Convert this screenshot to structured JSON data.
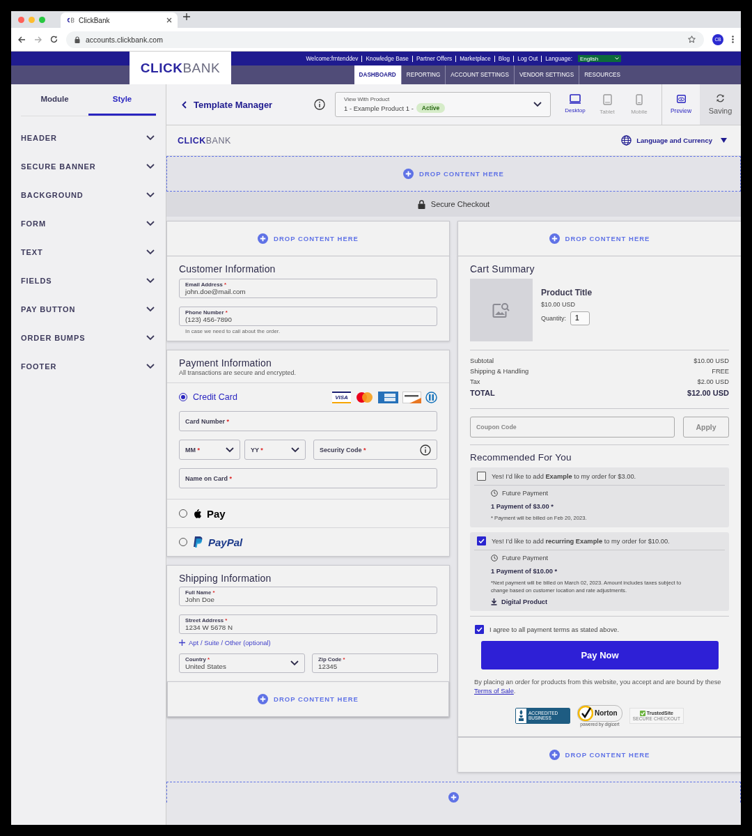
{
  "browser": {
    "tab_title": "ClickBank",
    "url": "accounts.clickbank.com",
    "avatar": "CB"
  },
  "site_header": {
    "logo_primary": "CLICK",
    "logo_secondary": "BANK",
    "links": [
      "Welcome:frntenddev",
      "Knowledge Base",
      "Partner Offers",
      "Marketplace",
      "Blog",
      "Log Out"
    ],
    "language_label": "Language:",
    "language_value": "English",
    "nav": [
      {
        "label": "DASHBOARD",
        "selected": true
      },
      {
        "label": "REPORTING",
        "selected": false
      },
      {
        "label": "ACCOUNT SETTINGS",
        "selected": false
      },
      {
        "label": "VENDOR SETTINGS",
        "selected": false
      },
      {
        "label": "RESOURCES",
        "selected": false
      }
    ]
  },
  "sidebar": {
    "tabs": [
      {
        "label": "Module",
        "selected": false
      },
      {
        "label": "Style",
        "selected": true
      }
    ],
    "sections": [
      "HEADER",
      "SECURE BANNER",
      "BACKGROUND",
      "FORM",
      "TEXT",
      "FIELDS",
      "PAY BUTTON",
      "ORDER BUMPS",
      "FOOTER"
    ]
  },
  "toolbar": {
    "title": "Template Manager",
    "product_select": {
      "label": "View With Product",
      "value": "1 - Example Product 1 -",
      "badge": "Active"
    },
    "devices": [
      {
        "kind": "desktop",
        "label": "Desktop",
        "selected": true
      },
      {
        "kind": "tablet",
        "label": "Tablet",
        "selected": false
      },
      {
        "kind": "mobile",
        "label": "Mobile",
        "selected": false
      }
    ],
    "preview": "Preview",
    "saving": "Saving"
  },
  "checkout": {
    "logo_primary": "CLICK",
    "logo_secondary": "BANK",
    "language": "Language and Currency",
    "header_drop": "DROP CONTENT HERE",
    "secure_banner": "Secure Checkout"
  },
  "left_column": {
    "drop_top": "DROP CONTENT HERE",
    "customer": {
      "title": "Customer Information",
      "fields": [
        {
          "label": "Email Address",
          "mark": "*",
          "value": "john.doe@mail.com"
        },
        {
          "label": "Phone Number",
          "mark": "*",
          "value": "(123) 456-7890"
        }
      ],
      "hint": "In case we need to call about the order."
    },
    "payment": {
      "title": "Payment Information",
      "subtitle": "All transactions are secure and encrypted.",
      "methods": [
        {
          "kind": "card",
          "label": "Credit Card",
          "selected": true
        },
        {
          "kind": "apple_pay",
          "label": "Pay",
          "selected": false
        },
        {
          "kind": "paypal",
          "label": "PayPal",
          "selected": false
        }
      ],
      "card_logos": [
        {
          "kind": "visa",
          "text": "VISA"
        },
        {
          "kind": "mastercard"
        },
        {
          "kind": "amex"
        },
        {
          "kind": "discover"
        },
        {
          "kind": "diners"
        }
      ],
      "card_fields": [
        {
          "label": "Card Number",
          "mark": "*"
        },
        {
          "kind": "select",
          "label": "MM",
          "mark": "*"
        },
        {
          "kind": "select",
          "label": "YY",
          "mark": "*"
        },
        {
          "kind": "info",
          "label": "Security Code",
          "mark": "*"
        },
        {
          "label": "Name on Card",
          "mark": "*"
        }
      ]
    },
    "shipping": {
      "title": "Shipping Information",
      "fields": [
        {
          "label": "Full Name",
          "mark": "*",
          "value": "John Doe"
        },
        {
          "label": "Street Address",
          "mark": "*",
          "value": "1234 W 5678 N"
        }
      ],
      "add_link": "Apt / Suite / Other (optional)",
      "row_fields": [
        {
          "kind": "select",
          "label": "Country",
          "mark": "*",
          "value": "United States"
        },
        {
          "label": "Zip Code",
          "mark": "*",
          "value": "12345"
        }
      ],
      "drop_bottom": "DROP CONTENT HERE"
    }
  },
  "cart": {
    "drop_top": "DROP CONTENT HERE",
    "title": "Cart Summary",
    "product": {
      "title": "Product Title",
      "price": "$10.00 USD",
      "quantity_label": "Quantity:",
      "quantity": "1"
    },
    "totals": [
      {
        "kind": "line",
        "label": "Subtotal",
        "value": "$10.00 USD"
      },
      {
        "kind": "line",
        "label": "Shipping & Handling",
        "value": "FREE"
      },
      {
        "kind": "line",
        "label": "Tax",
        "value": "$2.00 USD"
      },
      {
        "kind": "total",
        "label": "TOTAL",
        "value": "$12.00 USD"
      }
    ],
    "coupon_placeholder": "Coupon Code",
    "apply": "Apply",
    "recommended_title": "Recommended For You",
    "bumps": [
      {
        "checked": false,
        "text": "Yes! I'd like to add **Example** to my order for $3.00.",
        "schedule": "Future Payment",
        "payment": "1 Payment of $3.00 *",
        "note": "* Payment will be billed on Feb 20, 2023."
      },
      {
        "checked": true,
        "text": "Yes! I'd like to add **recurring Example** to my order for $10.00.",
        "schedule": "Future Payment",
        "payment": "1 Payment of $10.00 *",
        "note": "*Next payment will be billed on March 02, 2023. Amount includes taxes subject to change based on customer location and rate adjustments.",
        "digital": "Digital Product"
      }
    ],
    "agree": {
      "checked": true,
      "text": "I agree to all payment terms as stated above."
    },
    "pay_button": "Pay Now",
    "legal": {
      "text": "By placing an order for products from this website, you accept and are bound by these",
      "link": "Terms of Sale",
      "end": "."
    },
    "badges": {
      "bbb": "ACCREDITED BUSINESS",
      "norton": "Norton",
      "norton_sub": "powered by digicert",
      "trusted": "TrustedSite",
      "trusted_sub": "SECURE CHECKOUT"
    },
    "drop_bottom": "DROP CONTENT HERE"
  }
}
